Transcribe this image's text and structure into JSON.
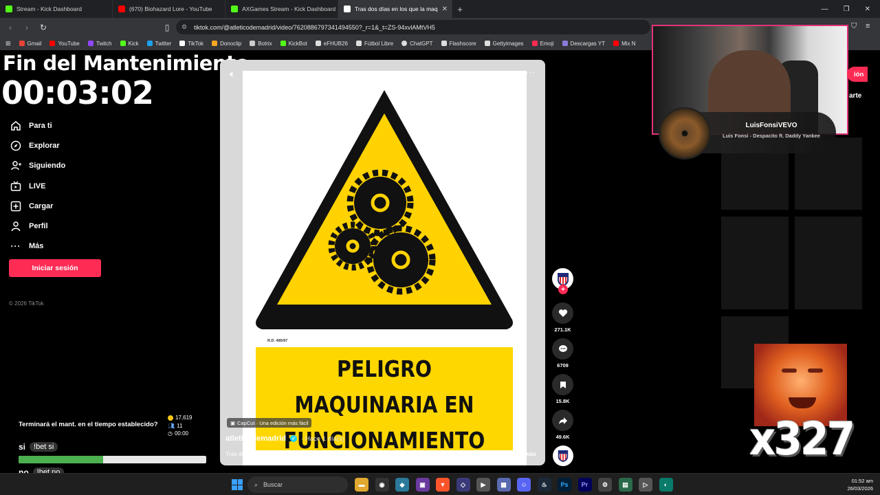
{
  "browser": {
    "tabs": [
      {
        "title": "Stream - Kick Dashboard",
        "color": "#53fc18"
      },
      {
        "title": "(670) Biohazard Lore - YouTube",
        "color": "#ff0000"
      },
      {
        "title": "AXGames Stream - Kick Dashboard",
        "color": "#53fc18"
      },
      {
        "title": "Tras dos días en los que la maq",
        "color": "#ffffff"
      }
    ],
    "url": "tiktok.com/@atleticodemadrid/video/7620886797341494550?_r=1&_t=ZS-94xvlAMtVH5",
    "bookmarks": [
      {
        "label": "Gmail",
        "color": "#ea4335"
      },
      {
        "label": "YouTube",
        "color": "#ff0000"
      },
      {
        "label": "Twitch",
        "color": "#9146ff"
      },
      {
        "label": "Kick",
        "color": "#53fc18"
      },
      {
        "label": "Twitter",
        "color": "#1da1f2"
      },
      {
        "label": "TikTok",
        "color": "#ffffff"
      },
      {
        "label": "Donoclip",
        "color": "#f5a623"
      },
      {
        "label": "Botrix",
        "color": "#cccccc"
      },
      {
        "label": "KickBot",
        "color": "#53fc18"
      },
      {
        "label": "eFHUB26",
        "color": "#dddddd"
      },
      {
        "label": "Fútbol Libre",
        "color": "#dddddd"
      },
      {
        "label": "ChatGPT",
        "color": "#dddddd"
      },
      {
        "label": "Flashscore",
        "color": "#dddddd"
      },
      {
        "label": "Gettyimages",
        "color": "#dddddd"
      },
      {
        "label": "Emoji",
        "color": "#fe2c55"
      },
      {
        "label": "Descargas YT",
        "color": "#8a7bd8"
      },
      {
        "label": "Mix N",
        "color": "#ff0000"
      }
    ]
  },
  "overlay": {
    "maintenance_title": "Fin del Mantenimiento",
    "maintenance_timer": "00:03:02"
  },
  "sidebar": {
    "items": [
      {
        "label": "Para ti",
        "icon": "home-icon"
      },
      {
        "label": "Explorar",
        "icon": "compass-icon"
      },
      {
        "label": "Siguiendo",
        "icon": "following-icon"
      },
      {
        "label": "LIVE",
        "icon": "live-icon"
      },
      {
        "label": "Cargar",
        "icon": "upload-icon"
      },
      {
        "label": "Perfil",
        "icon": "profile-icon"
      },
      {
        "label": "Más",
        "icon": "more-icon"
      }
    ],
    "login_label": "Iniciar sesión",
    "copyright": "© 2026 TikTok"
  },
  "video": {
    "rd_code": "R.D. 485/97",
    "sign_line1": "PELIGRO",
    "sign_line2": "MAQUINARIA EN",
    "sign_line3": "FUNCIONAMIENTO",
    "capcut_label": "CapCut · Una edición más fácil",
    "author": "atleticodemadrid",
    "posted": "· Hace 1 día(s)",
    "caption": "Tras dos días en los que la maquinaria ha puesto el foco en una jugada que hoy ha sido ratificada,",
    "more_label": "más"
  },
  "actions": {
    "likes": "271.1K",
    "comments": "6709",
    "saves": "15.8K",
    "shares": "49.6K"
  },
  "right_panel": {
    "signup_label": "ión",
    "part_label": "arte"
  },
  "now_playing": {
    "artist": "LuisFonsiVEVO",
    "song": "Luis Fonsi - Despacito ft. Daddy Yankee"
  },
  "emote": {
    "combo": "x327"
  },
  "poll": {
    "question": "Terminará el mant. en el tiempo establecido?",
    "coins": "17,619",
    "voters": "11",
    "time": "00:00",
    "options": [
      {
        "label": "si",
        "command": "!bet si",
        "share": 0.45
      },
      {
        "label": "no",
        "command": "!bet no",
        "share": 0.55
      }
    ]
  },
  "taskbar": {
    "search_placeholder": "Buscar",
    "time": "01:52 am",
    "date": "26/03/2026"
  }
}
